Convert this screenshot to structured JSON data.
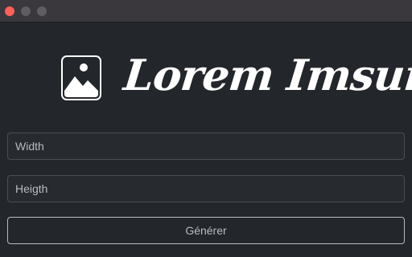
{
  "window": {
    "controls": [
      "close",
      "minimize",
      "maximize"
    ],
    "colors": {
      "close": "#fe5f57",
      "inactive": "#5f5d61",
      "titlebar": "#3a383c",
      "background": "#23262b"
    }
  },
  "logo": {
    "icon": "image-icon",
    "text": "Lorem Imsum"
  },
  "form": {
    "width_placeholder": "Width",
    "width_value": "",
    "height_placeholder": "Heigth",
    "height_value": "",
    "submit_label": "Générer"
  }
}
